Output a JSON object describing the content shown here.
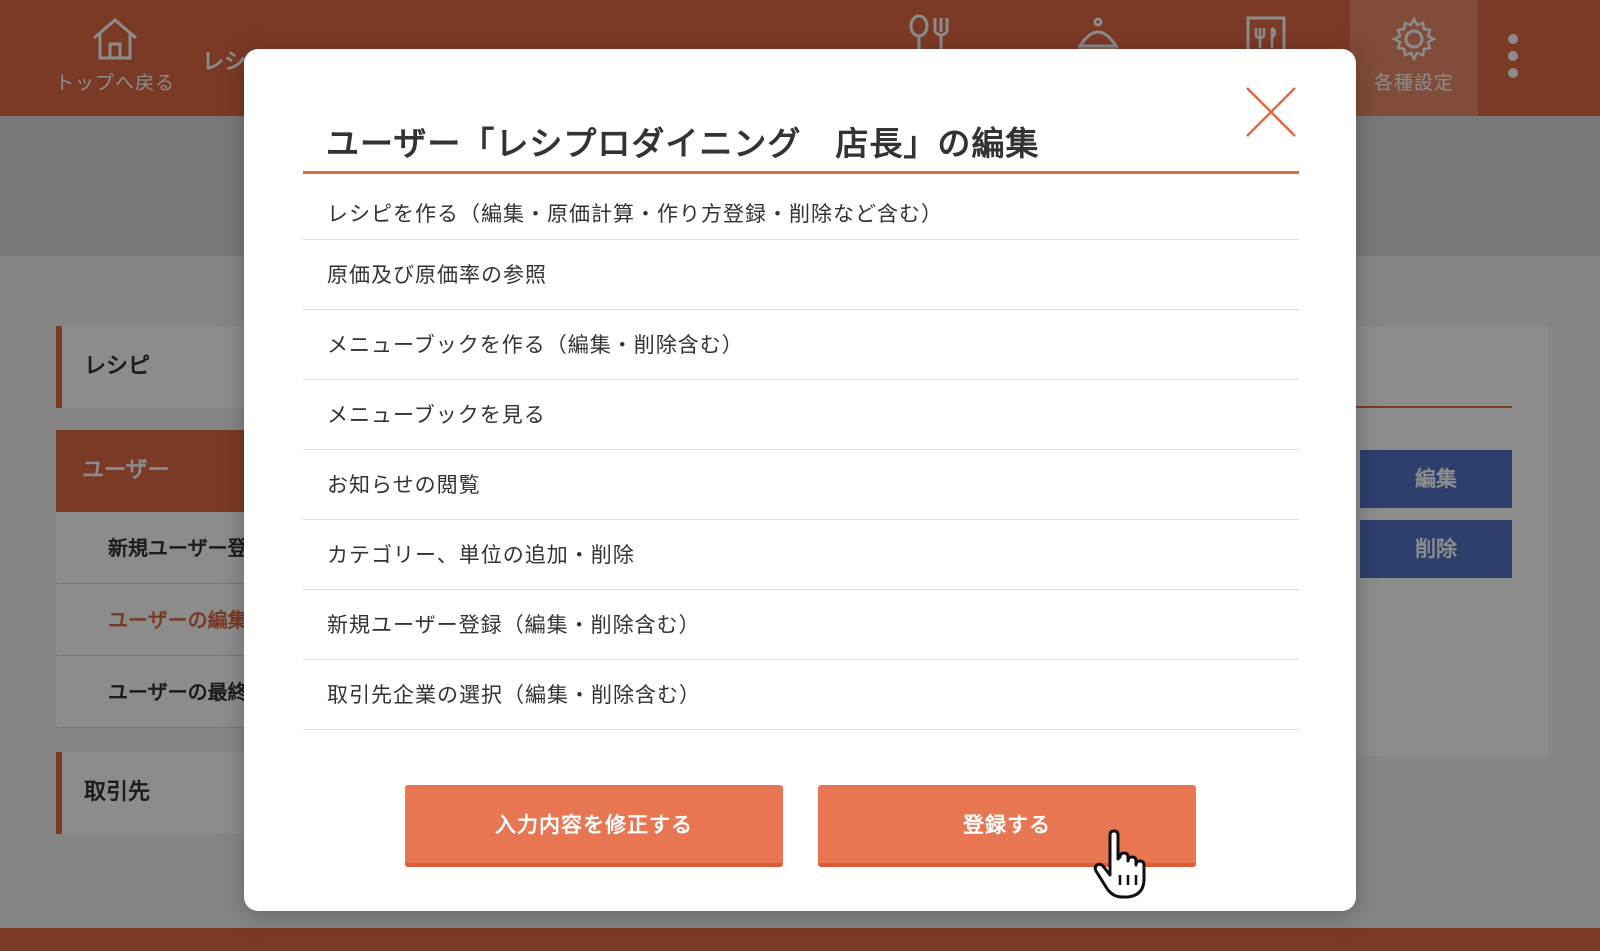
{
  "header": {
    "home_label": "トップへ戻る",
    "app_title": "レシ",
    "settings_label": "各種設定",
    "icons": [
      "cooking-tools-icon",
      "cloche-icon",
      "menu-board-icon"
    ]
  },
  "sidebar": {
    "recipe": "レシピ",
    "user": "ユーザー",
    "sub_items": [
      "新規ユーザー登",
      "ユーザーの編集",
      "ユーザーの最終"
    ],
    "partner": "取引先"
  },
  "right_panel": {
    "edit_label": "編集",
    "delete_label": "削除"
  },
  "modal": {
    "title": "ユーザー「レシプロダイニング　店長」の編集",
    "permissions": [
      "レシピを作る（編集・原価計算・作り方登録・削除など含む）",
      "原価及び原価率の参照",
      "メニューブックを作る（編集・削除含む）",
      "メニューブックを見る",
      "お知らせの閲覧",
      "カテゴリー、単位の追加・削除",
      "新規ユーザー登録（編集・削除含む）",
      "取引先企業の選択（編集・削除含む）"
    ],
    "fix_button": "入力内容を修正する",
    "register_button": "登録する"
  },
  "colors": {
    "accent": "#e06b45",
    "button_orange": "#e87652",
    "button_blue": "#5574c8"
  }
}
